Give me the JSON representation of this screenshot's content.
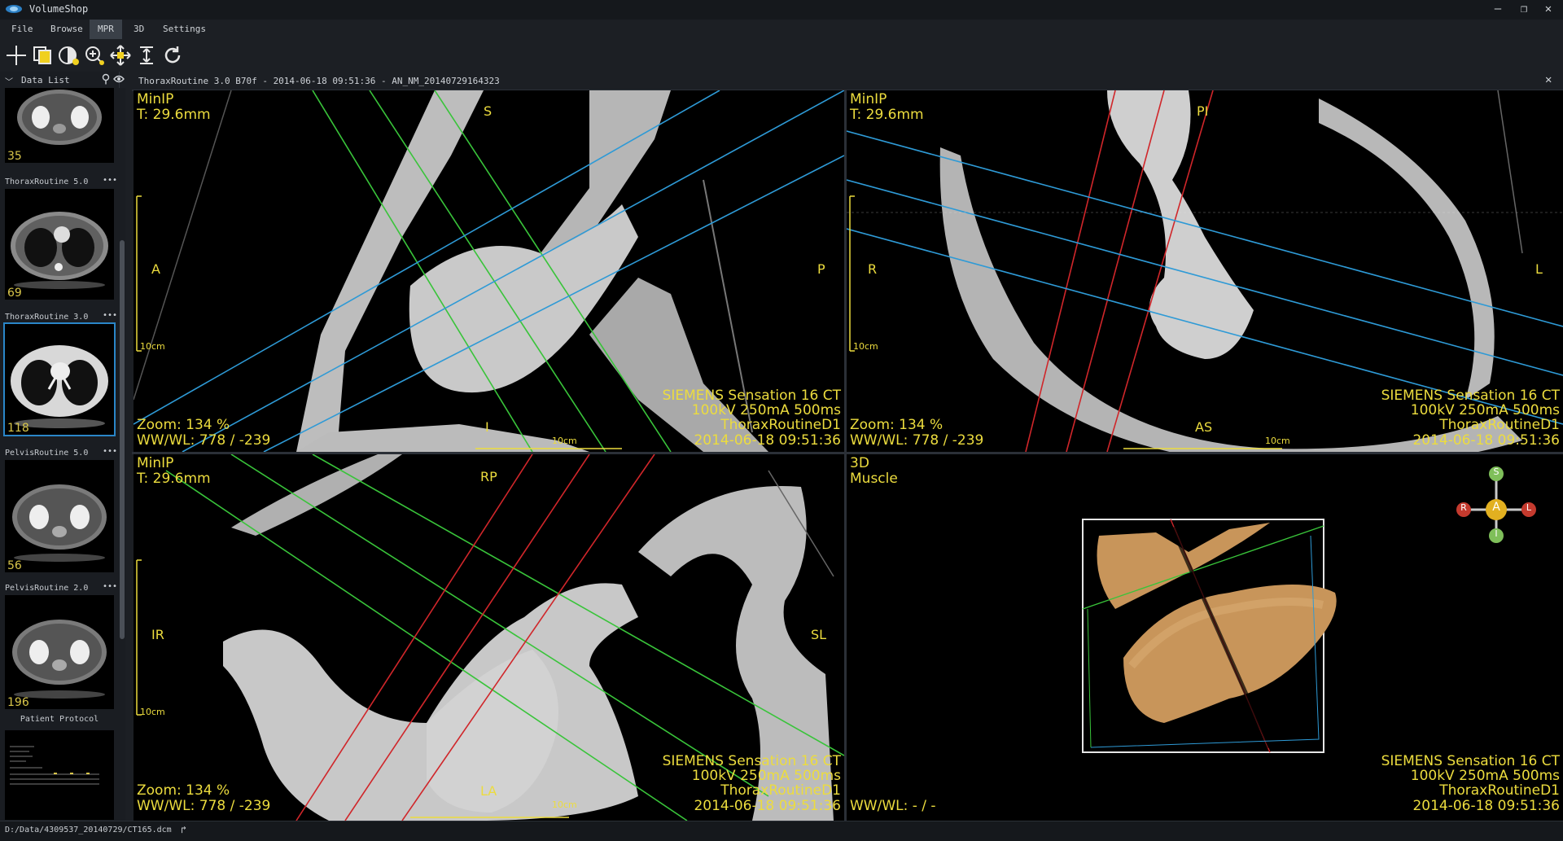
{
  "app": {
    "title": "VolumeShop"
  },
  "window_controls": {
    "minimize": "—",
    "maximize": "❐",
    "close": "✕"
  },
  "menu": [
    {
      "label": "File"
    },
    {
      "label": "Browse"
    },
    {
      "label": "MPR"
    },
    {
      "label": "3D"
    },
    {
      "label": "Settings"
    }
  ],
  "data_list": {
    "title": "Data List",
    "series": [
      {
        "name": "",
        "count": "35"
      },
      {
        "name": "ThoraxRoutine  5.0",
        "count": "69"
      },
      {
        "name": "ThoraxRoutine  3.0",
        "count": "118"
      },
      {
        "name": "PelvisRoutine  5.0",
        "count": "56"
      },
      {
        "name": "PelvisRoutine  2.0",
        "count": "196"
      }
    ],
    "more": "•••",
    "protocol_title": "Patient Protocol"
  },
  "viewer": {
    "title": "ThoraxRoutine  3.0  B70f - 2014-06-18 09:51:36 - AN_NM_20140729164323",
    "close": "✕"
  },
  "viewports": {
    "sagittal": {
      "mode": "MinIP",
      "thickness": "T: 29.6mm",
      "top": "S",
      "bottom": "I",
      "left": "A",
      "right": "P",
      "zoom": "Zoom: 134 %",
      "wwwl": "WW/WL: 778 / -239",
      "scale": "10cm",
      "info1": "SIEMENS  Sensation 16  CT",
      "info2": "100kV  250mA  500ms",
      "info3": "ThoraxRoutineD1",
      "info4": "2014-06-18 09:51:36"
    },
    "axial": {
      "mode": "MinIP",
      "thickness": "T: 29.6mm",
      "top": "PI",
      "bottom": "AS",
      "left": "R",
      "right": "L",
      "zoom": "Zoom: 134 %",
      "wwwl": "WW/WL: 778 / -239",
      "scale": "10cm",
      "info1": "SIEMENS  Sensation 16  CT",
      "info2": "100kV  250mA  500ms",
      "info3": "ThoraxRoutineD1",
      "info4": "2014-06-18 09:51:36"
    },
    "coronal": {
      "mode": "MinIP",
      "thickness": "T: 29.6mm",
      "top": "RP",
      "bottom": "LA",
      "left": "IR",
      "right": "SL",
      "zoom": "Zoom: 134 %",
      "wwwl": "WW/WL: 778 / -239",
      "scale": "10cm",
      "info1": "SIEMENS  Sensation 16  CT",
      "info2": "100kV  250mA  500ms",
      "info3": "ThoraxRoutineD1",
      "info4": "2014-06-18 09:51:36"
    },
    "volume3d": {
      "mode": "3D",
      "preset": "Muscle",
      "wwwl": "WW/WL: - / -",
      "info1": "SIEMENS  Sensation 16  CT",
      "info2": "100kV  250mA  500ms",
      "info3": "ThoraxRoutineD1",
      "info4": "2014-06-18 09:51:36",
      "cube": {
        "s": "S",
        "i": "I",
        "r": "R",
        "l": "L",
        "a": "A"
      }
    }
  },
  "status": {
    "path": "D:/Data/4309537_20140729/CT165.dcm",
    "arrow": "↱"
  },
  "colors": {
    "overlay": "#ecdc3e",
    "green_line": "#39c43a",
    "blue_line": "#2e9ad6",
    "red_line": "#d0262a",
    "selection": "#2a86c8"
  }
}
